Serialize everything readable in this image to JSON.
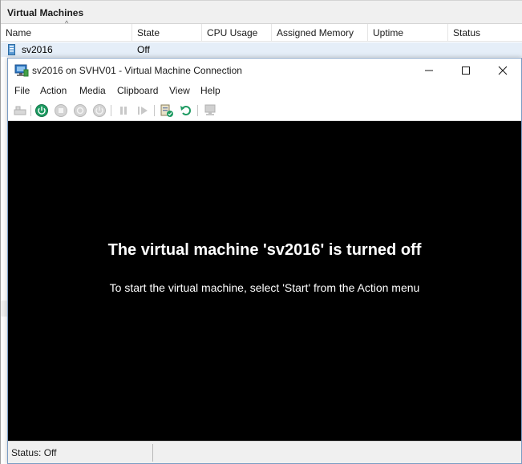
{
  "manager": {
    "panel_title": "Virtual Machines",
    "columns": [
      "Name",
      "State",
      "CPU Usage",
      "Assigned Memory",
      "Uptime",
      "Status"
    ],
    "rows": [
      {
        "name": "sv2016",
        "state": "Off"
      }
    ]
  },
  "connection": {
    "title": "sv2016 on SVHV01 - Virtual Machine Connection",
    "menu": [
      "File",
      "Action",
      "Media",
      "Clipboard",
      "View",
      "Help"
    ],
    "toolbar_icons": [
      "ctrl-alt-del-icon",
      "start-icon",
      "turn-off-icon",
      "shut-down-icon",
      "save-icon",
      "pause-icon",
      "reset-icon",
      "checkpoint-icon",
      "revert-icon",
      "enhanced-session-icon"
    ],
    "screen_heading": "The virtual machine 'sv2016' is turned off",
    "screen_message": "To start the virtual machine, select 'Start' from the Action menu",
    "status": "Status: Off"
  },
  "colors": {
    "accent_green": "#1e9b62",
    "selected_row": "#e5eef8",
    "screen_bg": "#000000"
  }
}
